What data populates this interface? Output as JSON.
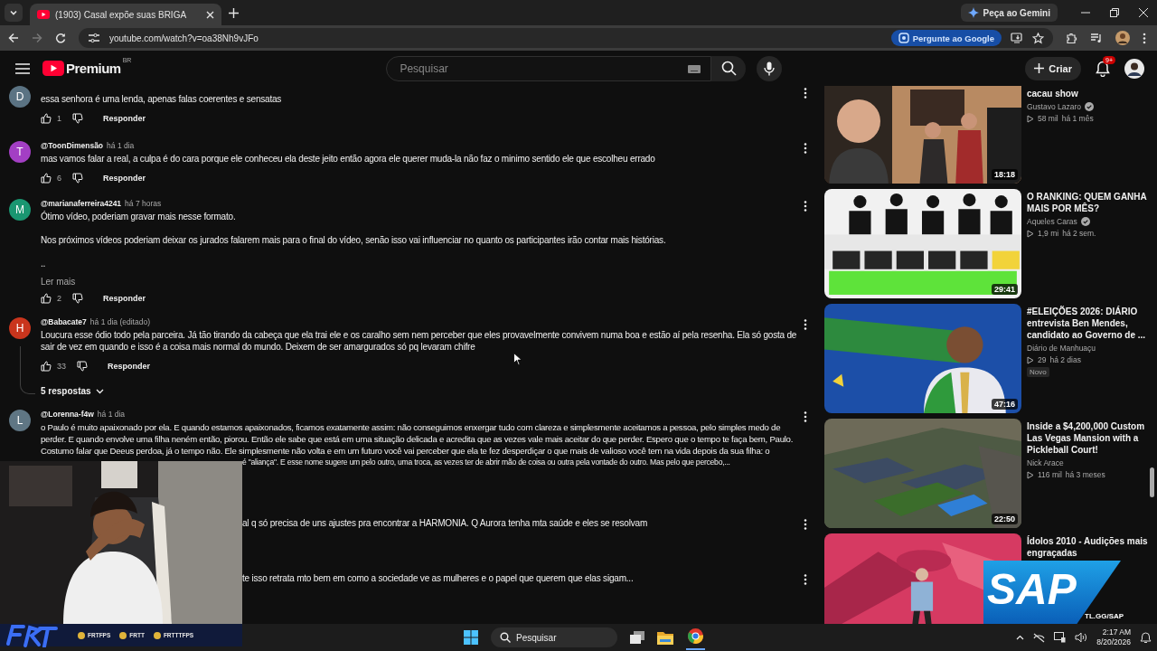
{
  "browser": {
    "tab": {
      "title": "(1903) Casal expõe suas BRIGA",
      "selected": true
    },
    "gemini": "Peça ao Gemini",
    "url": "youtube.com/watch?v=oa38Nh9vJFo",
    "ask_google": "Pergunte ao Google"
  },
  "header": {
    "brand": "Premium",
    "region": "BR",
    "search": {
      "placeholder": "Pesquisar"
    },
    "create": "Criar",
    "notifications": "9+"
  },
  "comments": [
    {
      "kind": "comment",
      "avatar": "D",
      "color": "#5b7383",
      "paragraphs": [
        "essa senhora é uma lenda, apenas falas coerentes e sensatas"
      ],
      "likes": "1",
      "reply": "Responder"
    },
    {
      "kind": "comment",
      "avatar": "T",
      "color": "#a33fc4",
      "author": "@ToonDimensão",
      "time": "há 1 dia",
      "paragraphs": [
        "mas vamos falar a real, a culpa é do cara porque ele conheceu ela deste jeito então agora ele querer muda-la não faz  o minimo sentido ele que escolheu errado"
      ],
      "likes": "6",
      "reply": "Responder"
    },
    {
      "kind": "comment",
      "avatar": "M",
      "color": "#1a9671",
      "author": "@marianaferreira4241",
      "time": "há 7 horas",
      "paragraphs": [
        "Ótimo vídeo, poderiam gravar mais nesse formato.",
        "Nos próximos vídeos poderiam deixar os jurados falarem mais para o final do vídeo, senão isso vai influenciar no quanto os participantes irão contar mais histórias.",
        ".."
      ],
      "more": "Ler mais",
      "likes": "2",
      "reply": "Responder"
    },
    {
      "kind": "comment",
      "avatar": "H",
      "color": "#c9351d",
      "author": "@Babacate7",
      "time": "há 1 dia (editado)",
      "paragraphs": [
        "Loucura esse ódio todo pela parceira. Já tão tirando da cabeça que ela trai ele e os caralho sem nem perceber que eles provavelmente convivem numa boa e estão aí pela resenha. Ela só gosta de sair de vez em quando e isso é a coisa mais normal do mundo. Deixem de ser amargurados só pq levaram chifre"
      ],
      "likes": "33",
      "reply": "Responder",
      "replies": "5 respostas"
    },
    {
      "kind": "comment",
      "avatar": "L",
      "color": "#5f7684",
      "author": "@Lorenna-f4w",
      "time": "há 1 dia",
      "lines": [
        "o Paulo é muito apaixonado por ela. E quando estamos apaixonados, ficamos exatamente assim: não conseguimos enxergar tudo com clareza e simplesmente aceitamos a pessoa, pelo simples medo de",
        "perder. E quando envolve uma filha neném então, piorou. Então ele sabe que está em uma situação delicada e acredita que as vezes vale mais aceitar do que perder. Espero que o tempo te faça bem, Paulo.",
        "Costumo falar que Deeus perdoa, já o tempo não. Ele simplesmente não volta e em um futuro você vai perceber que ela te fez desperdiçar o que mais de valioso você tem na vida depois da sua filha: o"
      ],
      "covered_line": "é \"aliança\". E esse nome sugere um pelo outro, uma troca, as vezes ter de abrir mão de coisa ou outra pela vontade do outro. Mas pelo que  percebo,..."
    },
    {
      "kind": "covered",
      "text": "al q só precisa de uns ajustes pra encontrar a HARMONIA. Q Aurora tenha mta saúde e eles se resolvam"
    },
    {
      "kind": "covered",
      "text": "te isso retrata mto bem em como a sociedade ve as mulheres e o papel que querem que elas sigam..."
    }
  ],
  "sidebar": [
    {
      "title": "cacau show",
      "channel": "Gustavo Lazaro",
      "verified": true,
      "views": "58 mil",
      "age": "há 1 mês",
      "duration": "18:18"
    },
    {
      "title": "O RANKING: QUEM GANHA MAIS POR MÊS?",
      "channel": "Aqueles Caras",
      "verified": true,
      "views": "1,9 mi",
      "age": "há 2 sem.",
      "duration": "29:41"
    },
    {
      "title": "#ELEIÇÕES 2026: DIÁRIO entrevista Ben Mendes, candidato ao Governo de ...",
      "channel": "Diário de Manhuaçu",
      "verified": false,
      "views": "29",
      "age": "há 2 dias",
      "badge": "Novo",
      "duration": "47:16"
    },
    {
      "title": "Inside a $4,200,000 Custom Las Vegas Mansion with a Pickleball Court!",
      "channel": "Nick Arace",
      "verified": false,
      "views": "116 mil",
      "age": "há 3 meses",
      "duration": "22:50"
    },
    {
      "title": "Ídolos 2010 - Audições mais engraçadas"
    }
  ],
  "webcam": {
    "socials": [
      "FRTFPS",
      "FRTT",
      "FRTTTFPS"
    ]
  },
  "sponsor": {
    "logo": "SAP",
    "link": "TL.GG/SAP"
  },
  "taskbar": {
    "search": {
      "placeholder": "Pesquisar"
    },
    "time": "2:17 AM",
    "date": "8/20/2026"
  }
}
